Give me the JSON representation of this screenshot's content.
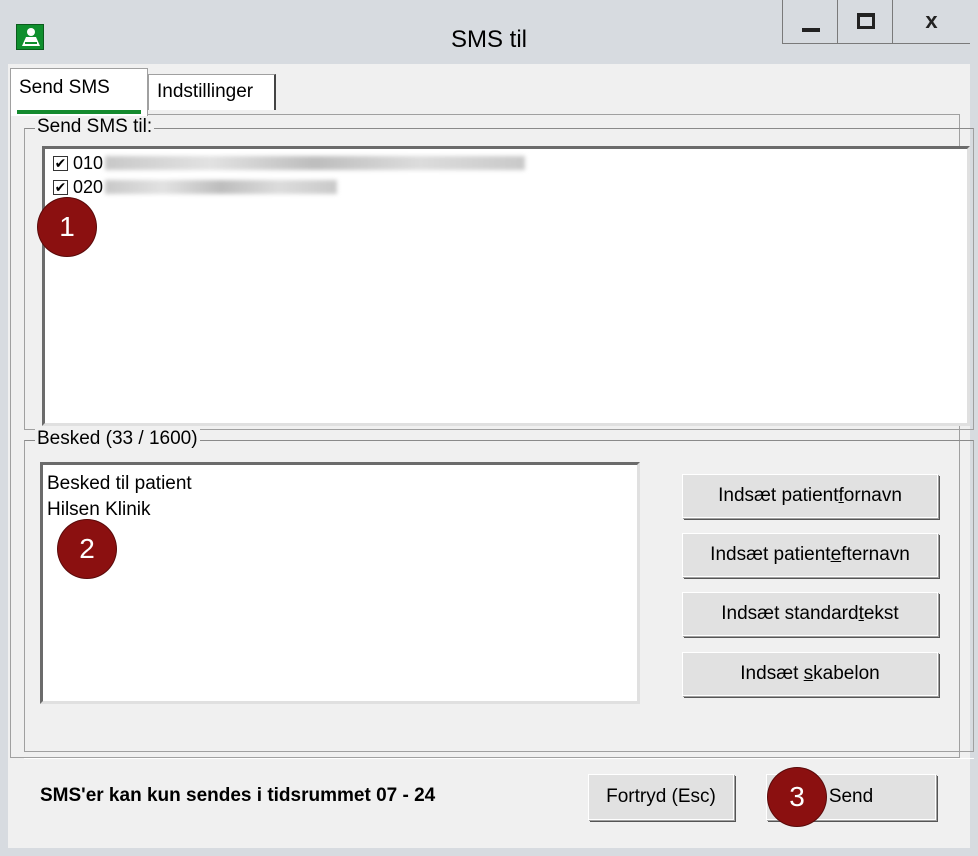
{
  "window": {
    "title": "SMS til",
    "icon": "app-person-icon"
  },
  "caption": {
    "minimize_icon": "minimize-icon",
    "maximize_icon": "maximize-icon",
    "close_label": "x"
  },
  "tabs": [
    {
      "label": "Send SMS",
      "active": true
    },
    {
      "label": "Indstillinger",
      "active": false
    }
  ],
  "recipients": {
    "legend": "Send SMS til:",
    "items": [
      {
        "prefix": "010",
        "checked": true,
        "checkmark": "✔"
      },
      {
        "prefix": "020",
        "checked": true,
        "checkmark": "✔"
      }
    ]
  },
  "message": {
    "legend": "Besked  (33 / 1600)",
    "lines": [
      "Besked til patient",
      "Hilsen Klinik"
    ]
  },
  "insert_buttons": [
    {
      "pre": "Indsæt patient",
      "key": "f",
      "post": "ornavn"
    },
    {
      "pre": "Indsæt patient",
      "key": "e",
      "post": "fternavn"
    },
    {
      "pre": "Indsæt standard",
      "key": "t",
      "post": "ekst"
    },
    {
      "pre": "Indsæt ",
      "key": "s",
      "post": "kabelon"
    }
  ],
  "footer": {
    "notice": "SMS'er kan kun sendes i tidsrummet 07 - 24",
    "cancel_label": "Fortryd (Esc)",
    "send_label": "Send"
  },
  "markers": [
    "1",
    "2",
    "3"
  ],
  "colors": {
    "accent": "#148a2e",
    "marker": "#8b1010",
    "window_frame": "#d7dbe0"
  }
}
